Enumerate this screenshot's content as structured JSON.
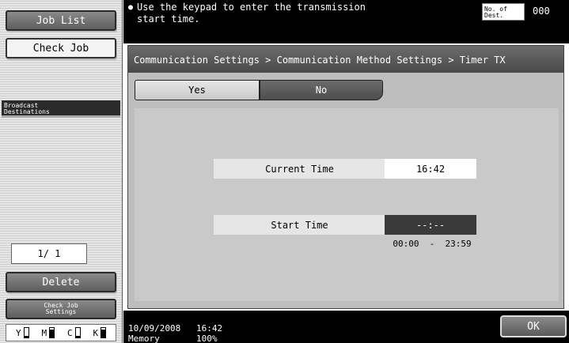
{
  "sidebar": {
    "job_list": "Job List",
    "check_job": "Check Job",
    "section_header": "Broadcast\nDestinations",
    "page_counter": "1/ 1",
    "delete": "Delete",
    "check_job_settings": "Check Job\nSettings",
    "toner": [
      {
        "label": "Y",
        "level": 0.15
      },
      {
        "label": "M",
        "level": 0.85
      },
      {
        "label": "C",
        "level": 0.15
      },
      {
        "label": "K",
        "level": 0.85
      }
    ]
  },
  "message": {
    "icon": "info-icon",
    "text": "Use the keypad to enter the transmission\nstart time.",
    "dest_label": "No. of\nDest.",
    "dest_count": "000"
  },
  "breadcrumb": "Communication Settings > Communication Method Settings > Timer TX",
  "tabs": {
    "yes": "Yes",
    "no": "No",
    "selected": "No"
  },
  "fields": {
    "current_time_label": "Current Time",
    "current_time_value": "16:42",
    "start_time_label": "Start Time",
    "start_time_value": "--:--",
    "range": "00:00  -  23:59"
  },
  "status": {
    "date": "10/09/2008",
    "time": "16:42",
    "memory_label": "Memory",
    "memory_value": "100%"
  },
  "ok": "OK"
}
